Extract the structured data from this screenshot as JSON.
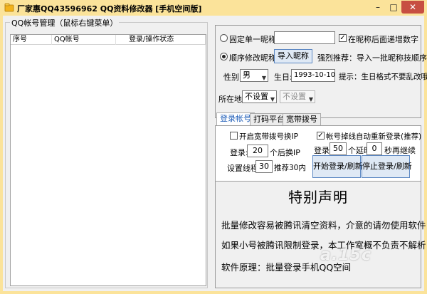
{
  "window": {
    "title": "厂家惠QQ43596962 QQ资料修改器 [手机空间版]",
    "controls": {
      "minimize": "–",
      "maximize": "□",
      "close": "✕"
    }
  },
  "accounts": {
    "group_title": "QQ帐号管理（鼠标右键菜单）",
    "columns": [
      "序号",
      "QQ帐号",
      "登录/操作状态"
    ],
    "rows": []
  },
  "nickname": {
    "fixed_label": "固定单一昵称:",
    "fixed_value": "",
    "fixed_selected": false,
    "append_digits_label": "在昵称后面递增数字",
    "append_digits_checked": true,
    "sequential_label": "顺序修改昵称:",
    "sequential_selected": true,
    "import_button": "导入昵称",
    "import_hint": "强烈推荐：导入一批昵称技顺序改!"
  },
  "profile": {
    "gender_label": "性别:",
    "gender_value": "男",
    "birthday_label": "生日:",
    "birthday_value": "1993-10-10",
    "birthday_hint": "提示：生日格式不要乱改哦",
    "location_label": "所在地:",
    "location_primary": "不设置",
    "location_secondary": "不设置"
  },
  "tabs": {
    "items": [
      "登录帐号",
      "打码平台",
      "宽带拨号"
    ],
    "active": 0
  },
  "login": {
    "broadband_ip_label": "开启宽带拨号换IP",
    "broadband_ip_checked": false,
    "relogin_label": "帐号掉线自动重新登录(推荐)",
    "relogin_checked": true,
    "login_count_label": "登录:",
    "login_count_value": "20",
    "login_count_suffix": "个后换IP",
    "batch_label": "登录",
    "batch_value": "50",
    "batch_mid": "个延时",
    "delay_value": "0",
    "delay_suffix": "秒再继续",
    "threads_label": "设置线程:",
    "threads_value": "30",
    "threads_suffix": "推荐30内",
    "start_button": "开始登录/刷新",
    "stop_button": "停止登录/刷新"
  },
  "notice": {
    "title": "特别声明",
    "lines": [
      "批量修改容易被腾讯清空资料，介意的请勿使用软件",
      "如果小号被腾讯限制登录，本工作室概不负责不解析",
      "软件原理：批量登录手机QQ空间"
    ]
  },
  "watermark": "a.15c",
  "colors": {
    "titlebar": "#fbe39a",
    "close": "#c74f42",
    "accent": "#1e5db8"
  },
  "icons": [
    "app-icon",
    "chevron-down-icon"
  ]
}
